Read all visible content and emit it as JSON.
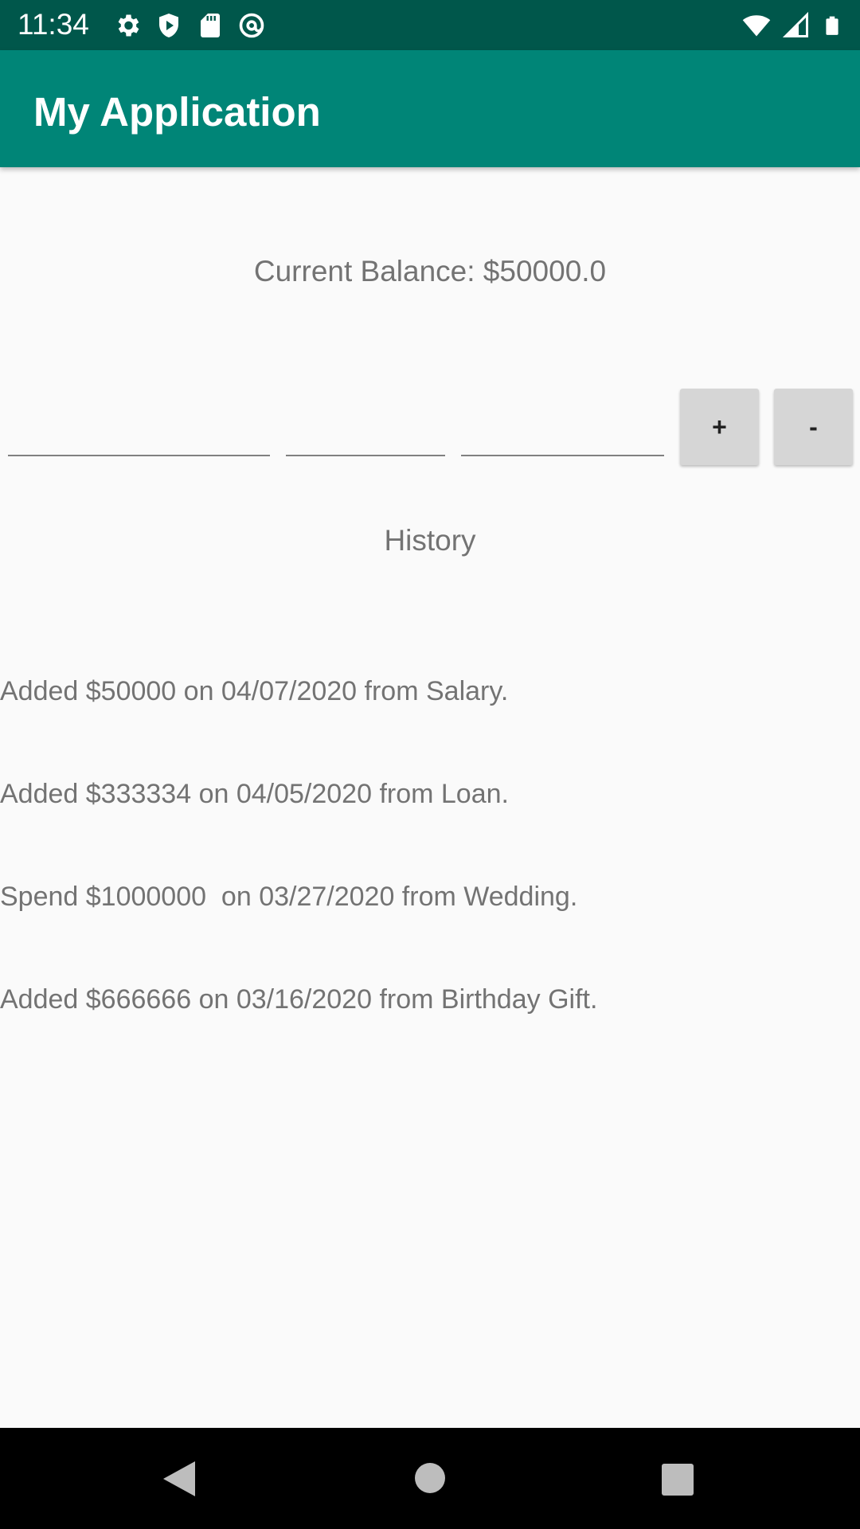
{
  "status_bar": {
    "time": "11:34",
    "icons_left": [
      "settings-icon",
      "shield-play-icon",
      "sd-card-icon",
      "at-sign-icon"
    ],
    "icons_right": [
      "wifi-icon",
      "signal-icon",
      "battery-icon"
    ]
  },
  "app_bar": {
    "title": "My Application"
  },
  "balance": {
    "text": "Current Balance: $50000.0"
  },
  "inputs": [
    {
      "value": "",
      "placeholder": ""
    },
    {
      "value": "",
      "placeholder": ""
    },
    {
      "value": "",
      "placeholder": ""
    }
  ],
  "buttons": {
    "add_label": "+",
    "subtract_label": "-"
  },
  "history": {
    "title": "History",
    "items": [
      "Added $50000 on 04/07/2020 from Salary.",
      "Added $333334 on 04/05/2020 from Loan.",
      "Spend $1000000  on 03/27/2020 from Wedding.",
      "Added $666666 on 03/16/2020 from Birthday Gift."
    ]
  },
  "nav_bar": {
    "icons": [
      "back-icon",
      "home-icon",
      "recents-icon"
    ]
  },
  "colors": {
    "status_bar": "#00574b",
    "app_bar": "#008577",
    "background": "#fafafa",
    "button": "#d6d6d6"
  }
}
